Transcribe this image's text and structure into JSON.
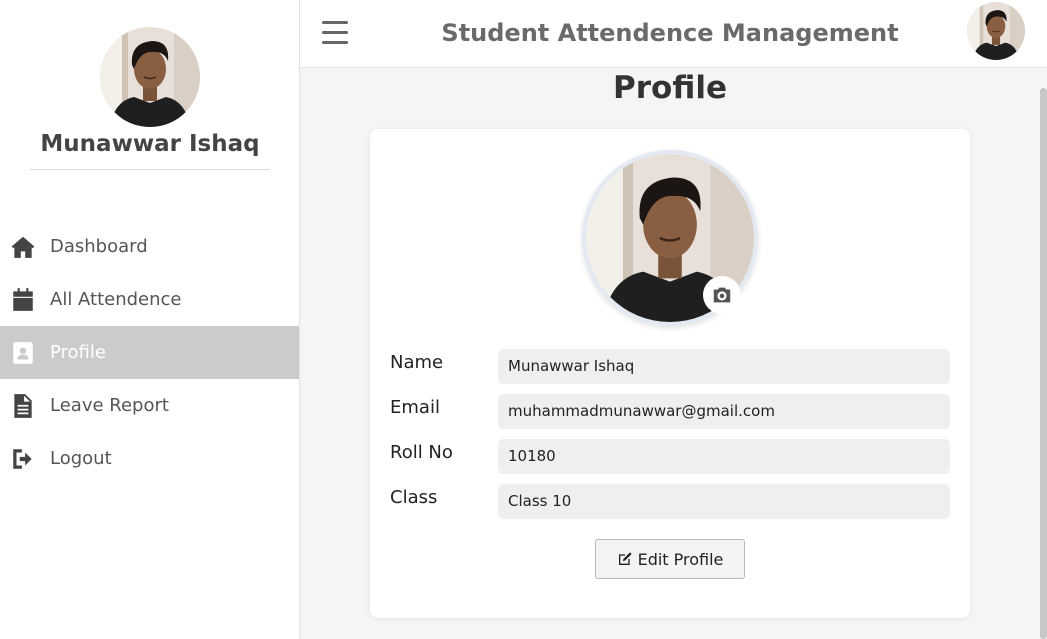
{
  "sidebar": {
    "user_name": "Munawwar Ishaq",
    "items": [
      {
        "label": "Dashboard",
        "icon": "home-icon"
      },
      {
        "label": "All Attendence",
        "icon": "calendar-check-icon"
      },
      {
        "label": "Profile",
        "icon": "id-badge-icon",
        "active": true
      },
      {
        "label": "Leave Report",
        "icon": "file-text-icon"
      },
      {
        "label": "Logout",
        "icon": "sign-out-icon"
      }
    ]
  },
  "header": {
    "title": "Student Attendence Management"
  },
  "main": {
    "page_title": "Profile",
    "fields": [
      {
        "label": "Name",
        "value": "Munawwar Ishaq"
      },
      {
        "label": "Email",
        "value": "muhammadmunawwar@gmail.com"
      },
      {
        "label": "Roll No",
        "value": "10180"
      },
      {
        "label": "Class",
        "value": "Class 10"
      }
    ],
    "edit_button_label": "Edit Profile"
  },
  "colors": {
    "active_nav_bg": "#cbcbcb",
    "page_bg": "#f5f5f5",
    "field_bg": "#efefef"
  }
}
